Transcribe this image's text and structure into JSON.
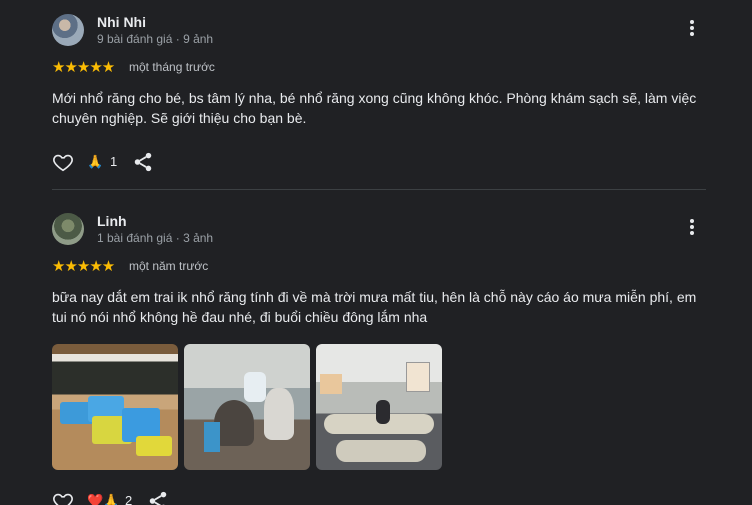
{
  "reviews": [
    {
      "author": "Nhi Nhi",
      "meta": "9 bài đánh giá · 9 ảnh",
      "stars": "★★★★★",
      "rating_value": 5,
      "when": "một tháng trước",
      "text": "Mới nhổ răng cho bé, bs tâm lý nha, bé nhổ răng xong cũng không khóc. Phòng khám sạch sẽ, làm việc chuyên nghiệp. Sẽ giới thiệu cho bạn bè.",
      "reactions": "🙏",
      "reaction_count": "1"
    },
    {
      "author": "Linh",
      "meta": "1 bài đánh giá · 3 ảnh",
      "stars": "★★★★★",
      "rating_value": 5,
      "when": "một năm trước",
      "text": "bữa nay dắt em trai ik nhổ răng tính đi về mà trời mưa mất tiu, hên là chỗ này cáo áo mưa miễn phí, em tui nó nói nhổ không hề đau nhé, đi buổi chiều đông lắm nha",
      "reactions": "❤️🙏",
      "reaction_count": "2"
    }
  ],
  "icons": {
    "like": "heart-outline-icon",
    "share": "share-icon",
    "more": "more-vert-icon"
  },
  "colors": {
    "background": "#202124",
    "star": "#fbbc04",
    "text": "#e8eaed",
    "secondary": "#9aa0a6"
  }
}
